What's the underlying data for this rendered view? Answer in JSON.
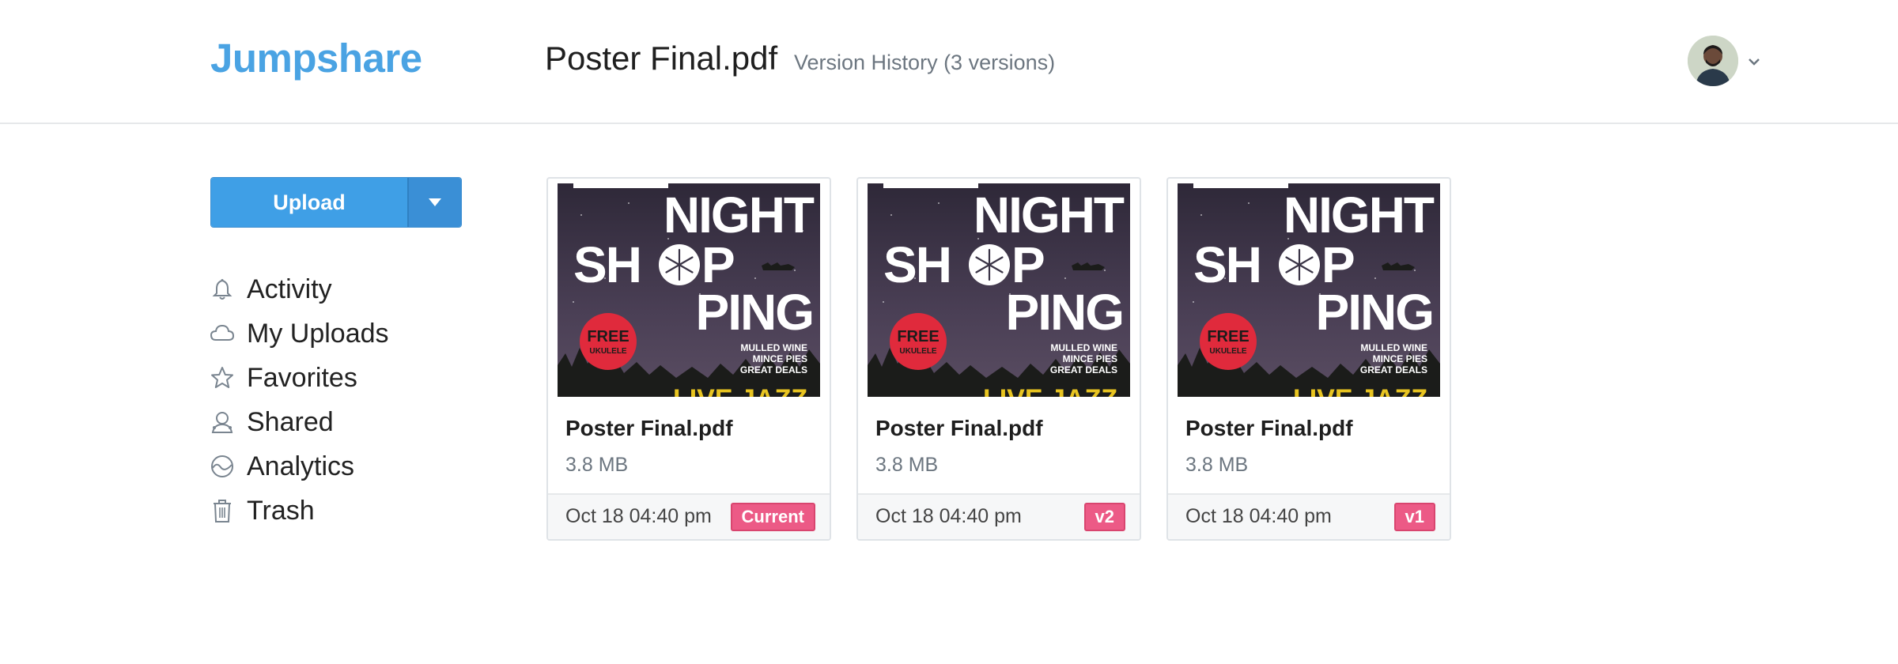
{
  "header": {
    "logo": "Jumpshare",
    "file_title": "Poster Final.pdf",
    "version_label": "Version History (3 versions)"
  },
  "sidebar": {
    "upload_label": "Upload",
    "items": [
      {
        "label": "Activity",
        "icon": "bell-icon"
      },
      {
        "label": "My Uploads",
        "icon": "cloud-icon"
      },
      {
        "label": "Favorites",
        "icon": "star-icon"
      },
      {
        "label": "Shared",
        "icon": "shared-user-icon"
      },
      {
        "label": "Analytics",
        "icon": "analytics-icon"
      },
      {
        "label": "Trash",
        "icon": "trash-icon"
      }
    ]
  },
  "versions": [
    {
      "name": "Poster Final.pdf",
      "size": "3.8 MB",
      "date": "Oct 18 04:40 pm",
      "badge": "Current"
    },
    {
      "name": "Poster Final.pdf",
      "size": "3.8 MB",
      "date": "Oct 18 04:40 pm",
      "badge": "v2"
    },
    {
      "name": "Poster Final.pdf",
      "size": "3.8 MB",
      "date": "Oct 18 04:40 pm",
      "badge": "v1"
    }
  ],
  "poster": {
    "line1": "NIGHT",
    "line2a": "SH",
    "line2b": "P",
    "line3": "PING",
    "free1": "FREE",
    "free2": "UKULELE",
    "list1": "MULLED WINE",
    "list2": "MINCE PIES",
    "list3": "GREAT DEALS",
    "footer_text": "LIVE JAZZ"
  },
  "colors": {
    "brand": "#4aa3e3",
    "upload": "#3f9fe6",
    "badge": "#ec5a86"
  }
}
